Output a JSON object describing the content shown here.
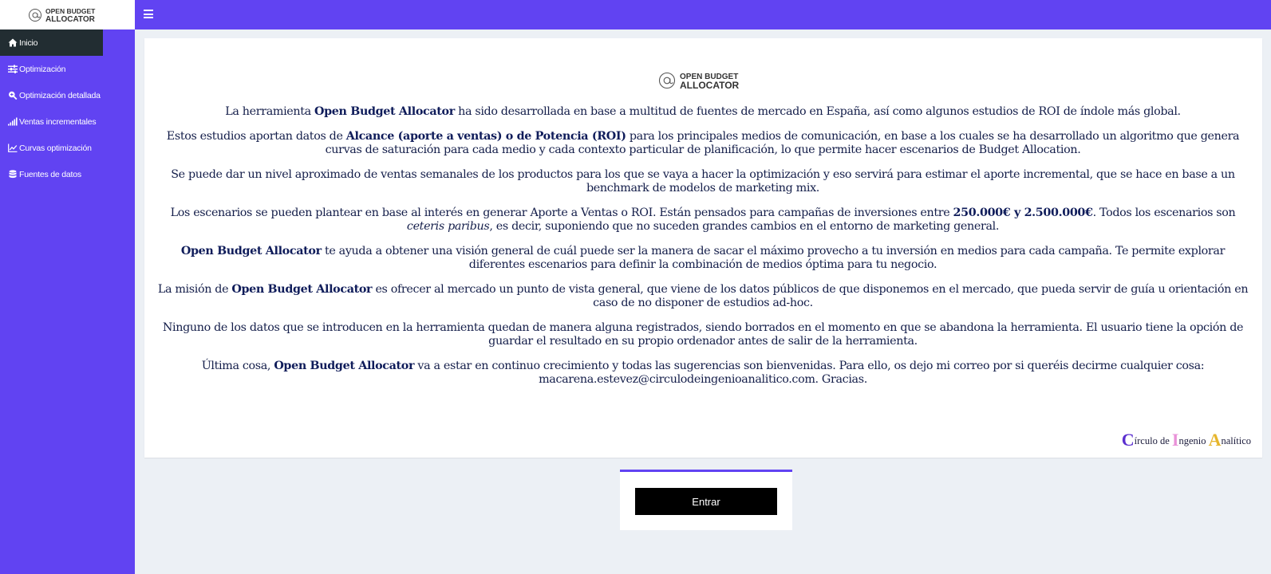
{
  "brand": {
    "line1": "OPEN BUDGET",
    "line2": "ALLOCATOR"
  },
  "sidebar": {
    "items": [
      {
        "label": "Inicio",
        "icon": "home-icon"
      },
      {
        "label": "Optimización",
        "icon": "sliders-icon"
      },
      {
        "label": "Optimización detallada",
        "icon": "search-plus-icon"
      },
      {
        "label": "Ventas incrementales",
        "icon": "signal-bars-icon"
      },
      {
        "label": "Curvas optimización",
        "icon": "line-chart-icon"
      },
      {
        "label": "Fuentes de datos",
        "icon": "database-icon"
      }
    ]
  },
  "main": {
    "paragraphs": [
      [
        "La herramienta ",
        {
          "b": "Open Budget Allocator"
        },
        " ha sido desarrollada en base a multitud de fuentes de mercado en España, así como algunos estudios de ROI de índole más global."
      ],
      [
        "Estos estudios aportan datos de ",
        {
          "b": "Alcance (aporte a ventas) o de Potencia (ROI)"
        },
        " para los principales medios de comunicación, en base a los cuales se ha desarrollado un algoritmo que genera curvas de saturación para cada medio y cada contexto particular de planificación, lo que permite hacer escenarios de Budget Allocation."
      ],
      [
        "Se puede dar un nivel aproximado de ventas semanales de los productos para los que se vaya a hacer la optimización y eso servirá para estimar el aporte incremental, que se hace en base a un benchmark de modelos de marketing mix."
      ],
      [
        "Los escenarios se pueden plantear en base al interés en generar Aporte a Ventas o ROI. Están pensados para campañas de inversiones entre ",
        {
          "b": "250.000€ y 2.500.000€"
        },
        ". Todos los escenarios son ",
        {
          "i": "ceteris paribus"
        },
        ", es decir, suponiendo que no suceden grandes cambios en el entorno de marketing general."
      ],
      [
        {
          "b": "Open Budget Allocator"
        },
        " te ayuda a obtener una visión general de cuál puede ser la manera de sacar el máximo provecho a tu inversión en medios para cada campaña. Te permite explorar diferentes escenarios para definir la combinación de medios óptima para tu negocio."
      ],
      [
        "La misión de ",
        {
          "b": "Open Budget Allocator"
        },
        " es ofrecer al mercado un punto de vista general, que viene de los datos públicos de que disponemos en el mercado, que pueda servir de guía u orientación en caso de no disponer de estudios ad-hoc."
      ],
      [
        "Ninguno de los datos que se introducen en la herramienta quedan de manera alguna registrados, siendo borrados en el momento en que se abandona la herramienta. El usuario tiene la opción de guardar el resultado en su propio ordenador antes de salir de la herramienta."
      ],
      [
        "Última cosa, ",
        {
          "b": "Open Budget Allocator"
        },
        " va a estar en continuo crecimiento y todas las sugerencias son bienvenidas. Para ello, os dejo mi correo por si queréis decirme cualquier cosa: macarena.estevez@circulodeingenioanalitico.com. Gracias."
      ]
    ],
    "footer_logo": {
      "c": "C",
      "c_rest": "írculo de ",
      "i": "I",
      "i_rest": "ngenio ",
      "a": "A",
      "a_rest": "nalítico"
    }
  },
  "login": {
    "button_label": "Entrar"
  },
  "colors": {
    "primary": "#6143f2",
    "active_nav": "#222d32",
    "background": "#ecf0f5",
    "text": "#141e4a"
  }
}
